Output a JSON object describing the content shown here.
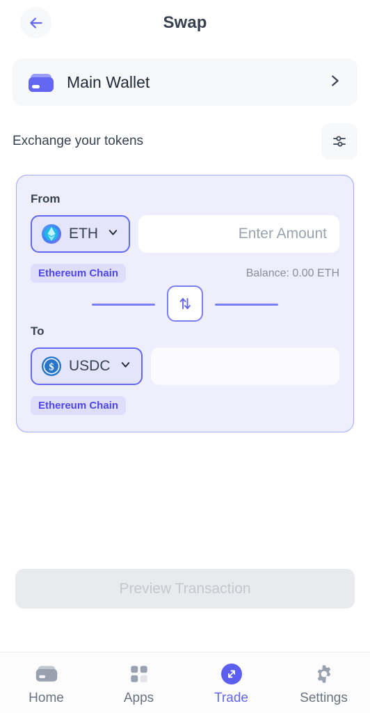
{
  "header": {
    "title": "Swap",
    "back_icon": "arrow-left-icon"
  },
  "wallet": {
    "name": "Main Wallet",
    "icon": "wallet-icon",
    "chevron_icon": "chevron-right-icon"
  },
  "exchange": {
    "label": "Exchange your tokens",
    "settings_icon": "sliders-icon"
  },
  "swap": {
    "from": {
      "label": "From",
      "token_symbol": "ETH",
      "token_icon": "eth-icon",
      "chevron_icon": "chevron-down-icon",
      "amount_value": "",
      "amount_placeholder": "Enter Amount",
      "chain": "Ethereum Chain",
      "balance": "Balance: 0.00 ETH"
    },
    "toggle": {
      "icon": "swap-vertical-icon"
    },
    "to": {
      "label": "To",
      "token_symbol": "USDC",
      "token_icon": "usdc-icon",
      "chevron_icon": "chevron-down-icon",
      "amount_value": "",
      "amount_placeholder": "",
      "chain": "Ethereum Chain",
      "balance": ""
    }
  },
  "action": {
    "preview_label": "Preview Transaction",
    "preview_enabled": false
  },
  "bottom_nav": {
    "items": [
      {
        "label": "Home",
        "icon": "wallet-icon",
        "active": false
      },
      {
        "label": "Apps",
        "icon": "grid-icon",
        "active": false
      },
      {
        "label": "Trade",
        "icon": "expand-icon",
        "active": true
      },
      {
        "label": "Settings",
        "icon": "gear-icon",
        "active": false
      }
    ]
  },
  "colors": {
    "accent": "#6366f1",
    "accent_light": "#7b7df5",
    "card_bg": "#eeeefc",
    "card_border": "#a5a6f6",
    "chip_bg": "#dedefb",
    "chip_text": "#4f46e5",
    "muted_text": "#6b7280",
    "title_text": "#374151",
    "disabled_bg": "#e9eaee",
    "disabled_text": "#c3c7ce",
    "usdc_blue": "#2775ca"
  }
}
